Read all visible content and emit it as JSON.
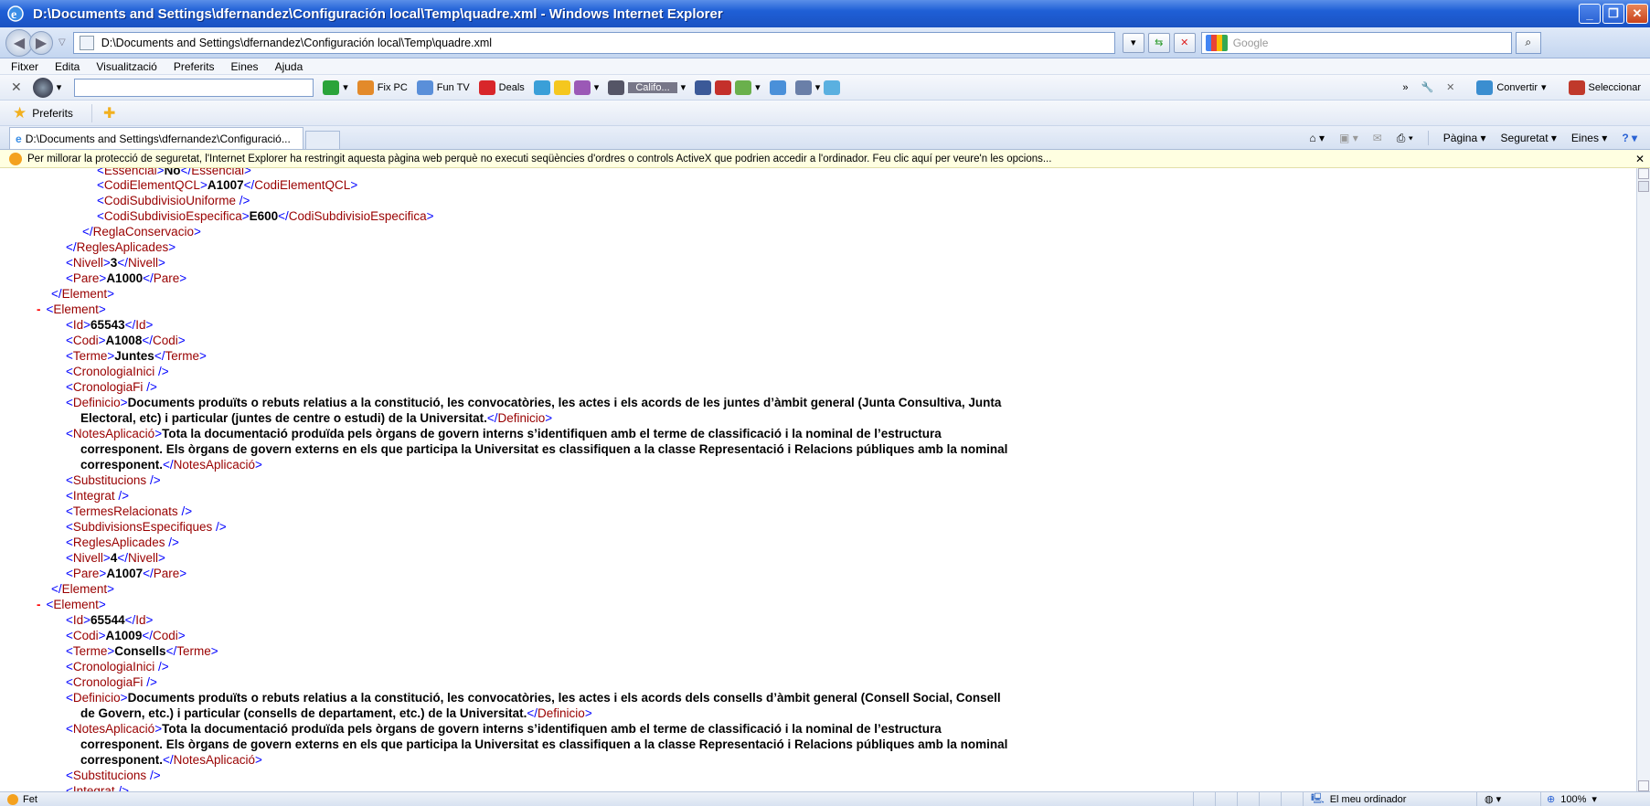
{
  "window": {
    "title": "D:\\Documents and Settings\\dfernandez\\Configuración local\\Temp\\quadre.xml - Windows Internet Explorer"
  },
  "address": {
    "url": "D:\\Documents and Settings\\dfernandez\\Configuración local\\Temp\\quadre.xml",
    "search_placeholder": "Google"
  },
  "menu": [
    "Fitxer",
    "Edita",
    "Visualització",
    "Preferits",
    "Eines",
    "Ajuda"
  ],
  "toolbar": {
    "fixpc": "Fix PC",
    "funtv": "Fun TV",
    "deals": "Deals",
    "weather": "Califo...",
    "convertir": "Convertir",
    "seleccionar": "Seleccionar"
  },
  "favorites": {
    "label": "Preferits"
  },
  "tab": {
    "title": "D:\\Documents and Settings\\dfernandez\\Configuració..."
  },
  "commands": {
    "pagina": "Pàgina",
    "seguretat": "Seguretat",
    "eines": "Eines"
  },
  "infobar": {
    "text": "Per millorar la protecció de seguretat, l'Internet Explorer ha restringit aquesta pàgina web perquè no executi seqüències d'ordres o controls ActiveX que podrien accedir a l'ordinador. Feu clic aquí per veure'n les opcions..."
  },
  "status": {
    "text": "Fet",
    "zone": "El meu ordinador",
    "zoom": "100%"
  },
  "xml": {
    "essencial": "No",
    "codiElementQCL": "A1007",
    "codiSubdivEsp": "E600",
    "nivel1": "3",
    "pare1": "A1000",
    "e1": {
      "id": "65543",
      "codi": "A1008",
      "terme": "Juntes",
      "def1": "Documents produïts o rebuts relatius a la constitució, les convocatòries, les actes i els acords de les juntes d’àmbit general (Junta Consultiva, Junta",
      "def2": "Electoral, etc) i particular (juntes de centre o estudi) de la Universitat.",
      "notes1": "Tota la documentació produïda pels òrgans de govern interns s’identifiquen amb el terme de classificació i la nominal de l’estructura",
      "notes2": "corresponent. Els òrgans de govern externs en els que participa la Universitat es classifiquen a la classe Representació i Relacions públiques amb la nominal",
      "notes3": "corresponent.",
      "nivel": "4",
      "pare": "A1007"
    },
    "e2": {
      "id": "65544",
      "codi": "A1009",
      "terme": "Consells",
      "def1": "Documents produïts o rebuts relatius a la constitució, les convocatòries, les actes i els acords dels consells d’àmbit general (Consell Social, Consell",
      "def2": "de Govern, etc.) i particular (consells de departament, etc.) de la Universitat.",
      "notes1": "Tota la documentació produïda pels òrgans de govern interns s’identifiquen amb el terme de classificació i la nominal de l’estructura",
      "notes2": "corresponent. Els òrgans de govern externs en els que participa la Universitat es classifiquen a la classe Representació i Relacions públiques amb la nominal",
      "notes3": "corresponent.",
      "nivel": "4",
      "pare": "A1007"
    }
  }
}
